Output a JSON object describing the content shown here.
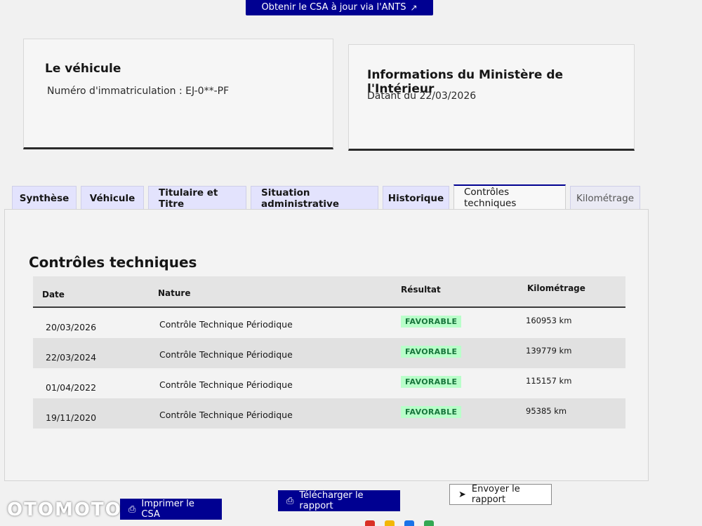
{
  "top": {
    "csa_button": "Obtenir le CSA à jour via l'ANTS"
  },
  "vehicle_card": {
    "title": "Le véhicule",
    "plate_label": "Numéro d'immatriculation : EJ-0**-PF"
  },
  "info_card": {
    "title": "Informations du Ministère de l'Intérieur",
    "date_text": "Datant du 22/03/2026"
  },
  "tabs": [
    {
      "label": "Synthèse"
    },
    {
      "label": "Véhicule"
    },
    {
      "label": "Titulaire et Titre"
    },
    {
      "label": "Situation administrative"
    },
    {
      "label": "Historique"
    },
    {
      "label": "Contrôles techniques"
    },
    {
      "label": "Kilométrage"
    }
  ],
  "section": {
    "title": "Contrôles techniques"
  },
  "table": {
    "headers": {
      "date": "Date",
      "nature": "Nature",
      "result": "Résultat",
      "km": "Kilométrage"
    },
    "rows": [
      {
        "date": "20/03/2026",
        "nature": "Contrôle Technique Périodique",
        "result": "FAVORABLE",
        "km": "160953 km"
      },
      {
        "date": "22/03/2024",
        "nature": "Contrôle Technique Périodique",
        "result": "FAVORABLE",
        "km": "139779 km"
      },
      {
        "date": "01/04/2022",
        "nature": "Contrôle Technique Périodique",
        "result": "FAVORABLE",
        "km": "115157 km"
      },
      {
        "date": "19/11/2020",
        "nature": "Contrôle Technique Périodique",
        "result": "FAVORABLE",
        "km": "95385 km"
      }
    ]
  },
  "actions": {
    "print": "Imprimer le CSA",
    "download": "Télécharger le rapport",
    "send": "Envoyer le rapport"
  },
  "watermark": "OTOMOTO",
  "colors": {
    "primary": "#000091",
    "tab_bg": "#e3e3fd",
    "badge_bg": "#b8fec9",
    "badge_text": "#18753c"
  },
  "icons": [
    "external-link-icon",
    "printer-icon",
    "send-icon"
  ]
}
